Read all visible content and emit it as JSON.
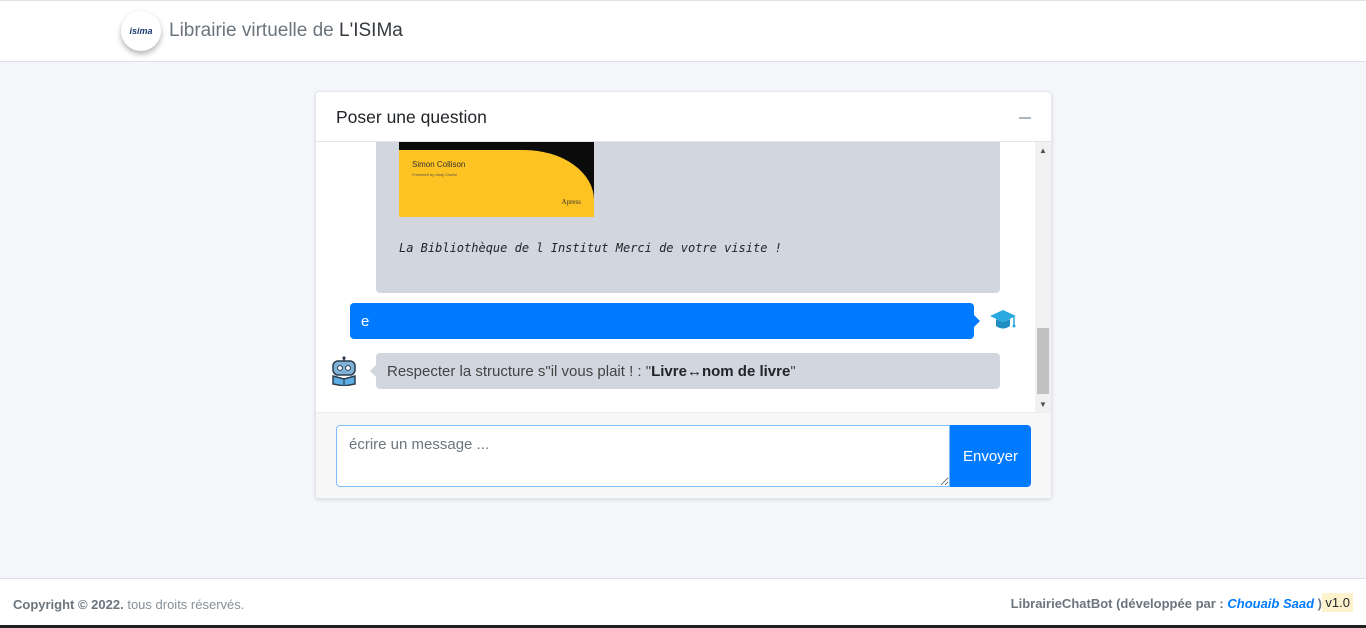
{
  "header": {
    "logo_text": "isima",
    "brand_prefix": "Librairie virtuelle de ",
    "brand_name": "L'ISIMa"
  },
  "chat": {
    "title": "Poser une question",
    "collapse_icon": "minus-icon",
    "messages": [
      {
        "sender": "bot",
        "book_author": "Simon Collison",
        "book_foreword": "Foreword by Andy Clarke",
        "book_publisher": "Apress",
        "text": "La Bibliothèque de l Institut Merci de votre visite !"
      },
      {
        "sender": "user",
        "text": "e",
        "avatar_icon": "graduation-cap-icon"
      },
      {
        "sender": "bot",
        "avatar_icon": "robot-reading-icon",
        "text_prefix": "Respecter la structure s\"il vous plait ! : \"",
        "text_bold": "Livre↔nom de livre",
        "text_suffix": "\""
      }
    ],
    "input": {
      "placeholder": "écrire un message ...",
      "value": ""
    },
    "send_label": "Envoyer"
  },
  "footer": {
    "copyright_bold": "Copyright © 2022.",
    "copyright_rest": " tous droits réservés.",
    "app_name": "LibrairieChatBot",
    "dev_prefix": " (développée par : ",
    "developer": "Chouaib Saad",
    "dev_suffix": " )",
    "version": "v1.0"
  },
  "colors": {
    "primary": "#007bff",
    "bot_bubble": "#d2d6de",
    "background": "#f4f6f9",
    "version_badge": "#fff3cd"
  }
}
